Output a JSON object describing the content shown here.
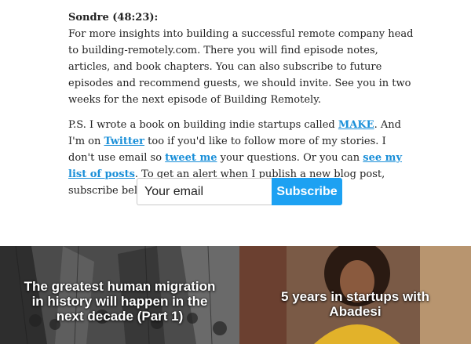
{
  "article": {
    "speaker": "Sondre (48:23):",
    "paragraph1": "For more insights into building a successful remote company head to building-remotely.com. There you will find episode notes, articles, and book chapters. You can also subscribe to future episodes and recommend guests, we should invite. See you in two weeks for the next episode of Building Remotely.",
    "ps": {
      "text1": "P.S. I wrote a book on building indie startups called ",
      "link_make": "MAKE",
      "text2": ". And I'm on ",
      "link_twitter": "Twitter",
      "text3": " too if you'd like to follow more of my stories. I don't use email so ",
      "link_tweet": "tweet me",
      "text4": " your questions. Or you can ",
      "link_posts": "see my list of posts",
      "text5": ". To get an alert when I publish a new blog post, subscribe below:"
    }
  },
  "signup": {
    "placeholder": "Your email",
    "button_label": "Subscribe"
  },
  "cards": [
    {
      "title": "The greatest human migration in history will happen in the next decade (Part 1)"
    },
    {
      "title": "5 years in startups with Abadesi"
    }
  ]
}
